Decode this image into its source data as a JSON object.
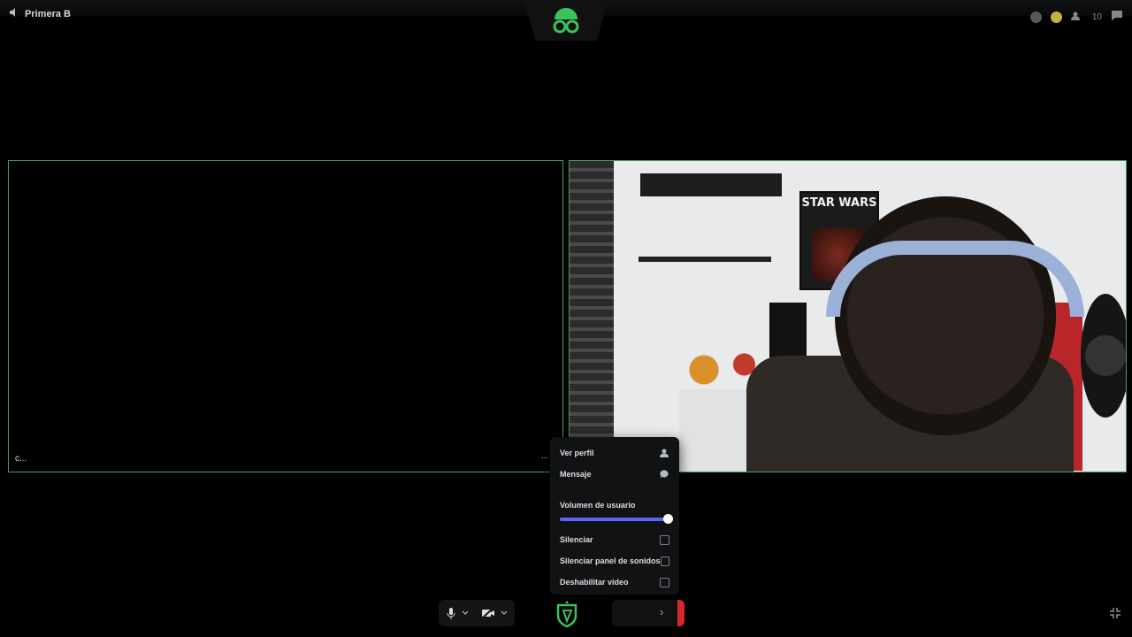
{
  "header": {
    "channel_name": "Primera B",
    "user_count": "10"
  },
  "tiles": {
    "left_name": "c...",
    "more_indicator": "..."
  },
  "webcam": {
    "poster_text": "STAR WARS"
  },
  "context_menu": {
    "items": [
      {
        "label": "Ver perfil",
        "icon": "user-icon"
      },
      {
        "label": "Mensaje",
        "icon": "chat-bubble-icon"
      }
    ],
    "volume_label": "Volumen de usuario",
    "volume_value": 1.0,
    "toggles": [
      {
        "label": "Silenciar",
        "checked": false
      },
      {
        "label": "Silenciar panel de sonidos",
        "checked": false
      },
      {
        "label": "Deshabilitar video",
        "checked": false
      }
    ]
  },
  "controls": {
    "mic_icon": "microphone-icon",
    "camera_icon": "camera-off-icon",
    "activity_icon": "shield-icon",
    "collapse_icon": "collapse-icon"
  },
  "colors": {
    "accent": "#3ea35c",
    "slider": "#5865f2",
    "end_call": "#d6262e"
  }
}
